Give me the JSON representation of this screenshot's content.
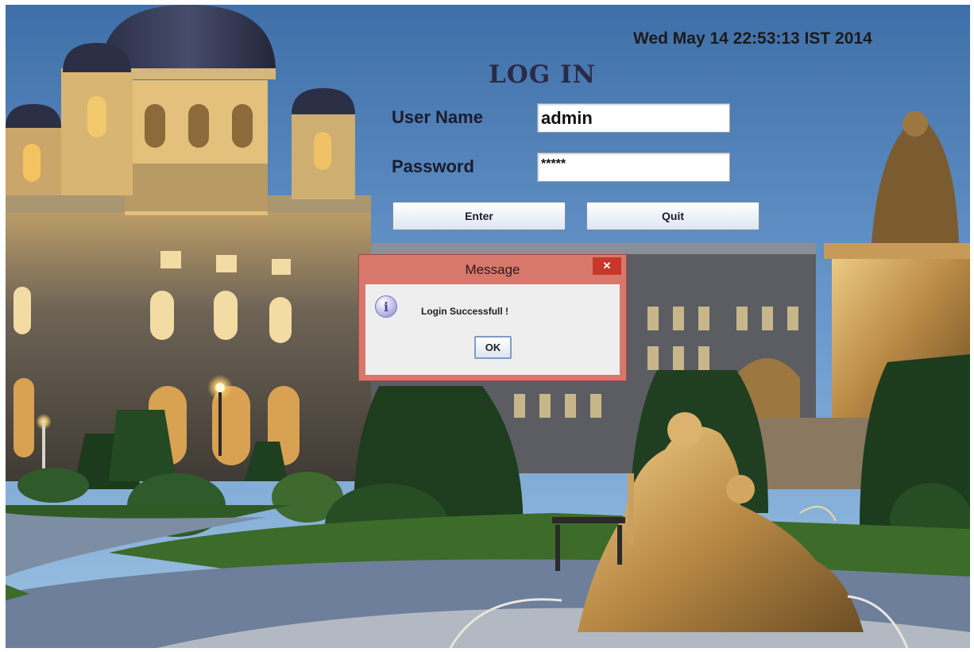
{
  "datetime": "Wed May 14 22:53:13 IST 2014",
  "login": {
    "title": "LOG IN",
    "username_label": "User Name",
    "username_value": "admin",
    "password_label": "Password",
    "password_value": "*****",
    "enter_label": "Enter",
    "quit_label": "Quit"
  },
  "dialog": {
    "title": "Message",
    "close_glyph": "✕",
    "icon_glyph": "i",
    "message": "Login Successfull !",
    "ok_label": "OK"
  },
  "background_icon": "palace-night-scene-image"
}
